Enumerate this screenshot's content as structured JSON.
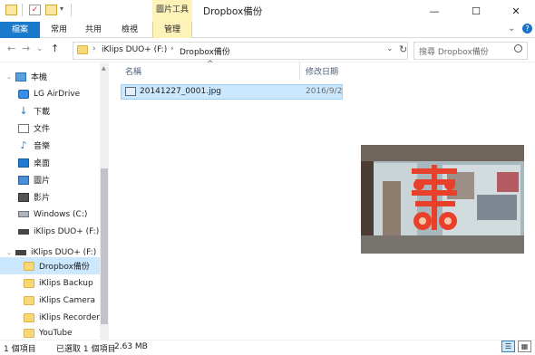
{
  "window": {
    "title": "Dropbox備份",
    "tools_tab_header": "圖片工具",
    "minimize": "—",
    "maximize": "☐",
    "close": "✕"
  },
  "ribbon": {
    "tabs": [
      "檔案",
      "常用",
      "共用",
      "檢視",
      "管理"
    ],
    "expand": "⌄",
    "help": "?"
  },
  "nav_buttons": {
    "back": "←",
    "forward": "→",
    "dropdown": "⌄",
    "up": "↑"
  },
  "address": {
    "segments": [
      "iKlips DUO+ (F:)",
      "Dropbox備份"
    ],
    "separator": "›",
    "refresh": "↻"
  },
  "search": {
    "placeholder": "搜尋 Dropbox備份",
    "icon": "search-icon"
  },
  "nav_pane": {
    "items": [
      {
        "label": "本機",
        "icon": "pc-icon",
        "expandable": true
      },
      {
        "label": "LG AirDrive",
        "icon": "airdrive-icon"
      },
      {
        "label": "下載",
        "icon": "downloads-icon"
      },
      {
        "label": "文件",
        "icon": "documents-icon"
      },
      {
        "label": "音樂",
        "icon": "music-icon"
      },
      {
        "label": "桌面",
        "icon": "desktop-icon"
      },
      {
        "label": "圖片",
        "icon": "pictures-icon"
      },
      {
        "label": "影片",
        "icon": "videos-icon"
      },
      {
        "label": "Windows (C:)",
        "icon": "drive-icon"
      },
      {
        "label": "iKlips DUO+ (F:)",
        "icon": "usb-drive-icon"
      },
      {
        "label": "iKlips DUO+ (F:)",
        "icon": "usb-drive-icon",
        "expandable": true
      },
      {
        "label": "Dropbox備份",
        "icon": "folder-icon",
        "selected": true
      },
      {
        "label": "iKlips Backup",
        "icon": "folder-icon"
      },
      {
        "label": "iKlips Camera",
        "icon": "folder-icon"
      },
      {
        "label": "iKlips Recorder",
        "icon": "folder-icon"
      },
      {
        "label": "YouTube",
        "icon": "folder-icon"
      }
    ]
  },
  "file_list": {
    "columns": [
      "名稱",
      "修改日期"
    ],
    "sort_indicator": "^",
    "files": [
      {
        "name": "20141227_0001.jpg",
        "modified": "2016/9/2",
        "selected": true
      }
    ]
  },
  "status_bar": {
    "item_count": "1 個項目",
    "selected": "已選取 1 個項目",
    "size": "2.63 MB"
  },
  "colors": {
    "accent": "#1979ca",
    "selection": "#cce8ff",
    "tools_tab": "#fdf3b9",
    "preview_sign": "#e8402a"
  }
}
